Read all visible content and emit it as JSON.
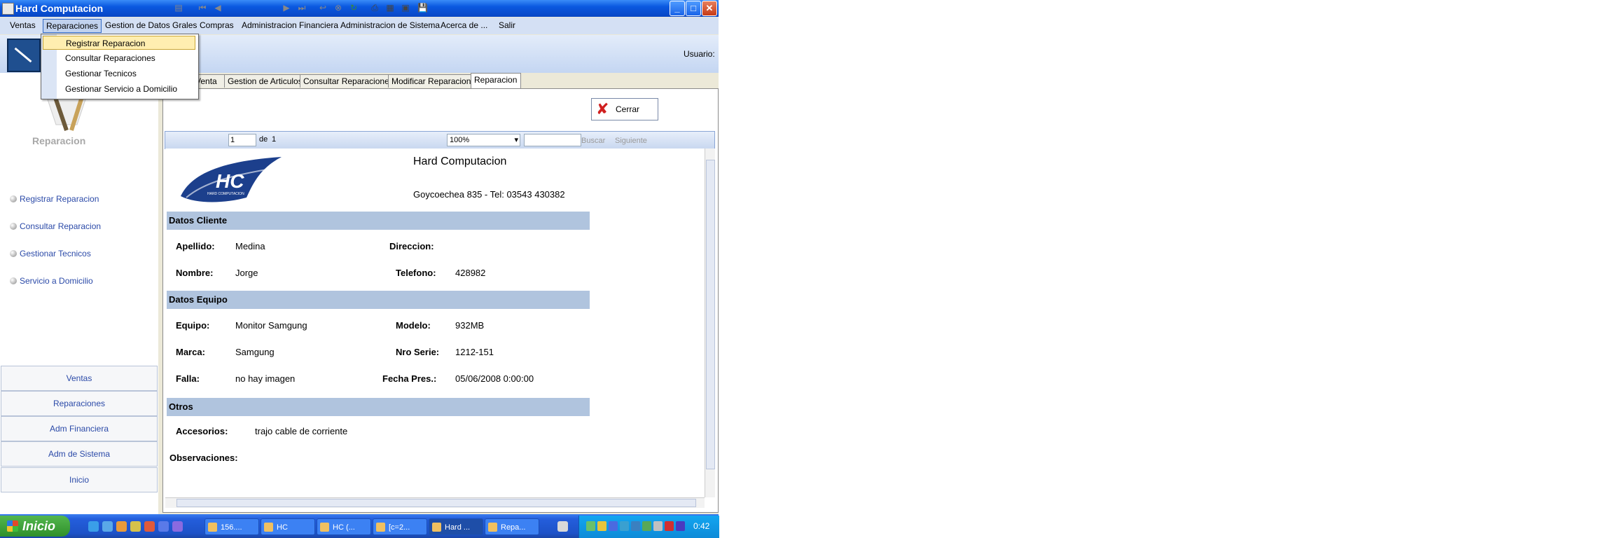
{
  "window": {
    "title": "Hard Computacion",
    "min": "_",
    "max": "□",
    "close": "✕"
  },
  "menu": {
    "items": [
      "Ventas",
      "Reparaciones",
      "Gestion de Datos Grales",
      "Compras",
      "Administracion Financiera",
      "Administracion de Sistema",
      "Acerca de ...",
      "Salir"
    ],
    "active": "Reparaciones"
  },
  "dropdown": [
    "Registrar Reparacion",
    "Consultar Reparaciones",
    "Gestionar Tecnicos",
    "Gestionar Servicio a Domicilio"
  ],
  "toolbar": {
    "usuario_label": "Usuario:"
  },
  "sidebar": {
    "logo_label": "Reparacion",
    "links": [
      "Registrar Reparacion",
      "Consultar Reparacion",
      "Gestionar Tecnicos",
      "Servicio a Domicilio"
    ],
    "nav": [
      "Ventas",
      "Reparaciones",
      "Adm Financiera",
      "Adm de Sistema",
      "Inicio"
    ]
  },
  "tabs": [
    "Venta",
    "Gestion de Articulos",
    "Consultar Reparaciones",
    "Modificar Reparacion",
    "Reparacion"
  ],
  "selected_tab": "Reparacion",
  "close_button": "Cerrar",
  "viewer": {
    "page": "1",
    "of_label": "de",
    "total": "1",
    "zoom": "100%",
    "find": "Buscar",
    "next": "Siguiente"
  },
  "report": {
    "logo_text": "HC",
    "logo_sub": "HARD COMPUTACION",
    "company": "Hard Computacion",
    "address": "Goycoechea 835 - Tel: 03543 430382",
    "sections": {
      "cliente": "Datos Cliente",
      "equipo": "Datos Equipo",
      "otros": "Otros"
    },
    "cliente": {
      "apellido_l": "Apellido:",
      "apellido": "Medina",
      "direccion_l": "Direccion:",
      "direccion": "",
      "nombre_l": "Nombre:",
      "nombre": "Jorge",
      "telefono_l": "Telefono:",
      "telefono": "428982"
    },
    "equipo": {
      "equipo_l": "Equipo:",
      "equipo": "Monitor Samgung",
      "modelo_l": "Modelo:",
      "modelo": "932MB",
      "marca_l": "Marca:",
      "marca": "Samgung",
      "serie_l": "Nro Serie:",
      "serie": "1212-151",
      "falla_l": "Falla:",
      "falla": "no hay imagen",
      "fecha_l": "Fecha Pres.:",
      "fecha": "05/06/2008 0:00:00"
    },
    "otros": {
      "accesorios_l": "Accesorios:",
      "accesorios": "trajo cable de corriente",
      "obs_l": "Observaciones:",
      "obs": ""
    }
  },
  "taskbar": {
    "start": "Inicio",
    "tasks": [
      "156....",
      "HC",
      "HC (...",
      "[c=2...",
      "Hard ...",
      "Repa..."
    ],
    "clock": "0:42"
  }
}
